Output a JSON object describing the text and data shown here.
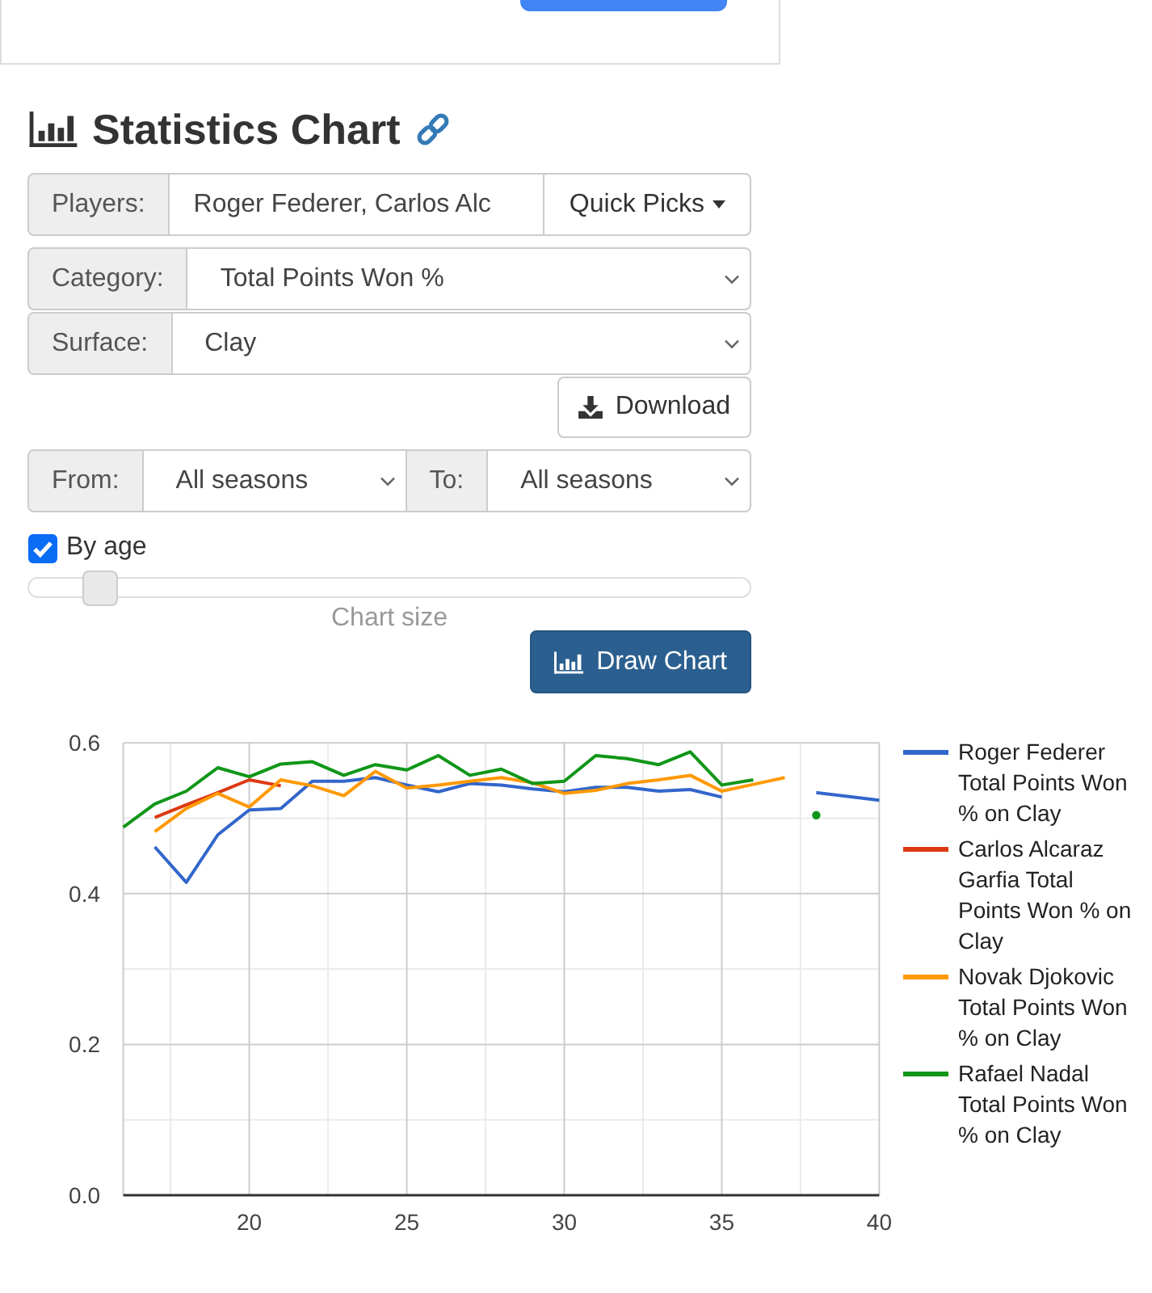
{
  "heading": {
    "title": "Statistics Chart"
  },
  "form": {
    "players": {
      "label": "Players:",
      "value": "Roger Federer, Carlos Alc",
      "button": "Quick Picks"
    },
    "category": {
      "label": "Category:",
      "value": "Total Points Won %"
    },
    "surface": {
      "label": "Surface:",
      "value": "Clay"
    },
    "download_button": "Download",
    "range": [
      {
        "label": "From:",
        "value": "All seasons"
      },
      {
        "label": "To:",
        "value": "All seasons"
      }
    ],
    "by_age": {
      "label": "By age",
      "checked": true
    },
    "chart_size": {
      "label": "Chart size",
      "level": 0.08
    },
    "draw_button": "Draw Chart"
  },
  "chart": {
    "chart_data": {
      "type": "line",
      "grid": true,
      "legend": true,
      "x": [
        16,
        17,
        18,
        19,
        20,
        21,
        22,
        23,
        24,
        25,
        26,
        27,
        28,
        29,
        30,
        31,
        32,
        33,
        34,
        35,
        36,
        37,
        38,
        39,
        40
      ],
      "xlim": [
        16,
        40
      ],
      "ylim": [
        0,
        0.6
      ],
      "xticks": [
        20,
        25,
        30,
        35,
        40
      ],
      "yticks": [
        {
          "value": 0,
          "label": "0.0"
        },
        {
          "value": 0.2,
          "label": "0.2"
        },
        {
          "value": 0.4,
          "label": "0.4"
        },
        {
          "value": 0.6,
          "label": "0.6"
        }
      ],
      "series": [
        {
          "name": "Roger Federer Total Points Won % on Clay",
          "color": "#3366cc",
          "values": [
            null,
            0.462,
            0.415,
            0.478,
            0.511,
            0.513,
            0.549,
            0.549,
            0.554,
            0.544,
            0.535,
            0.546,
            0.544,
            0.539,
            0.535,
            0.541,
            0.541,
            0.536,
            0.538,
            0.528,
            null,
            null,
            0.534,
            0.529,
            0.524
          ]
        },
        {
          "name": "Carlos Alcaraz Garfia Total Points Won % on Clay",
          "color": "#dc3912",
          "values": [
            null,
            0.501,
            0.518,
            0.534,
            0.551,
            0.543,
            null,
            null,
            null,
            null,
            null,
            null,
            null,
            null,
            null,
            null,
            null,
            null,
            null,
            null,
            null,
            null,
            null,
            null,
            null
          ]
        },
        {
          "name": "Novak Djokovic Total Points Won % on Clay",
          "color": "#ff9900",
          "values": [
            null,
            0.482,
            0.513,
            0.533,
            0.515,
            0.551,
            0.543,
            0.53,
            0.562,
            0.54,
            0.544,
            0.549,
            0.554,
            0.547,
            0.533,
            0.537,
            0.546,
            0.551,
            0.557,
            0.536,
            0.545,
            0.554,
            null,
            null,
            null
          ]
        },
        {
          "name": "Rafael Nadal Total Points Won % on Clay",
          "color": "#109618",
          "values": [
            0.488,
            0.519,
            0.536,
            0.567,
            0.555,
            0.572,
            0.575,
            0.557,
            0.571,
            0.564,
            0.583,
            0.557,
            0.565,
            0.546,
            0.549,
            0.583,
            0.579,
            0.571,
            0.588,
            0.544,
            0.551,
            null,
            0.504,
            null,
            null
          ]
        }
      ]
    }
  }
}
